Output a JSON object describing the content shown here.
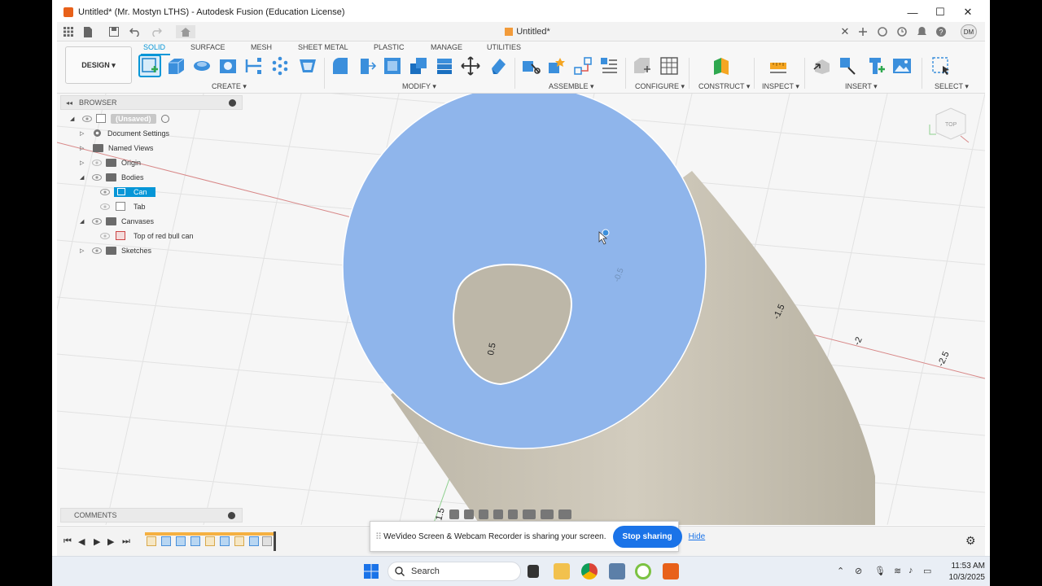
{
  "window": {
    "title": "Untitled* (Mr. Mostyn LTHS) - Autodesk Fusion (Education License)",
    "minimize": "—",
    "maximize": "☐",
    "close": "✕"
  },
  "appbar": {
    "doc_tab": "Untitled*",
    "doc_tab_close": "✕",
    "avatar": "DM"
  },
  "ribbon": {
    "workspace": "DESIGN ▾",
    "tabs": [
      "SOLID",
      "SURFACE",
      "MESH",
      "SHEET METAL",
      "PLASTIC",
      "MANAGE",
      "UTILITIES"
    ],
    "groups": [
      "CREATE ▾",
      "MODIFY ▾",
      "ASSEMBLE ▾",
      "CONFIGURE ▾",
      "CONSTRUCT ▾",
      "INSPECT ▾",
      "INSERT ▾",
      "SELECT ▾"
    ],
    "accent": "#0696d7"
  },
  "browser": {
    "header": "BROWSER",
    "nodes": [
      {
        "label": "(Unsaved)",
        "icon": "document-icon"
      },
      {
        "label": "Document Settings",
        "icon": "gear-icon"
      },
      {
        "label": "Named Views",
        "icon": "folder-icon"
      },
      {
        "label": "Origin",
        "icon": "folder-icon"
      },
      {
        "label": "Bodies",
        "icon": "folder-icon"
      },
      {
        "label": "Can",
        "icon": "body-icon",
        "selected": true
      },
      {
        "label": "Tab",
        "icon": "body-icon"
      },
      {
        "label": "Canvases",
        "icon": "folder-icon"
      },
      {
        "label": "Top of red bull can",
        "icon": "canvas-icon"
      },
      {
        "label": "Sketches",
        "icon": "folder-icon"
      }
    ]
  },
  "viewport": {
    "view_cube": "TOP",
    "axis_labels": [
      "-1.5",
      "-2",
      "-2.5",
      "0.5",
      "-0.5",
      "1.5"
    ],
    "body_color": "#8fb5eb",
    "cylinder_color": "#c9c3b4"
  },
  "comments": {
    "header": "COMMENTS"
  },
  "share_banner": {
    "grip": "⠿",
    "message": "WeVideo Screen & Webcam Recorder is sharing your screen.",
    "stop_button": "Stop sharing",
    "hide_link": "Hide"
  },
  "taskbar": {
    "search_placeholder": "Search",
    "time": "11:53 AM",
    "date": "10/3/2025"
  }
}
